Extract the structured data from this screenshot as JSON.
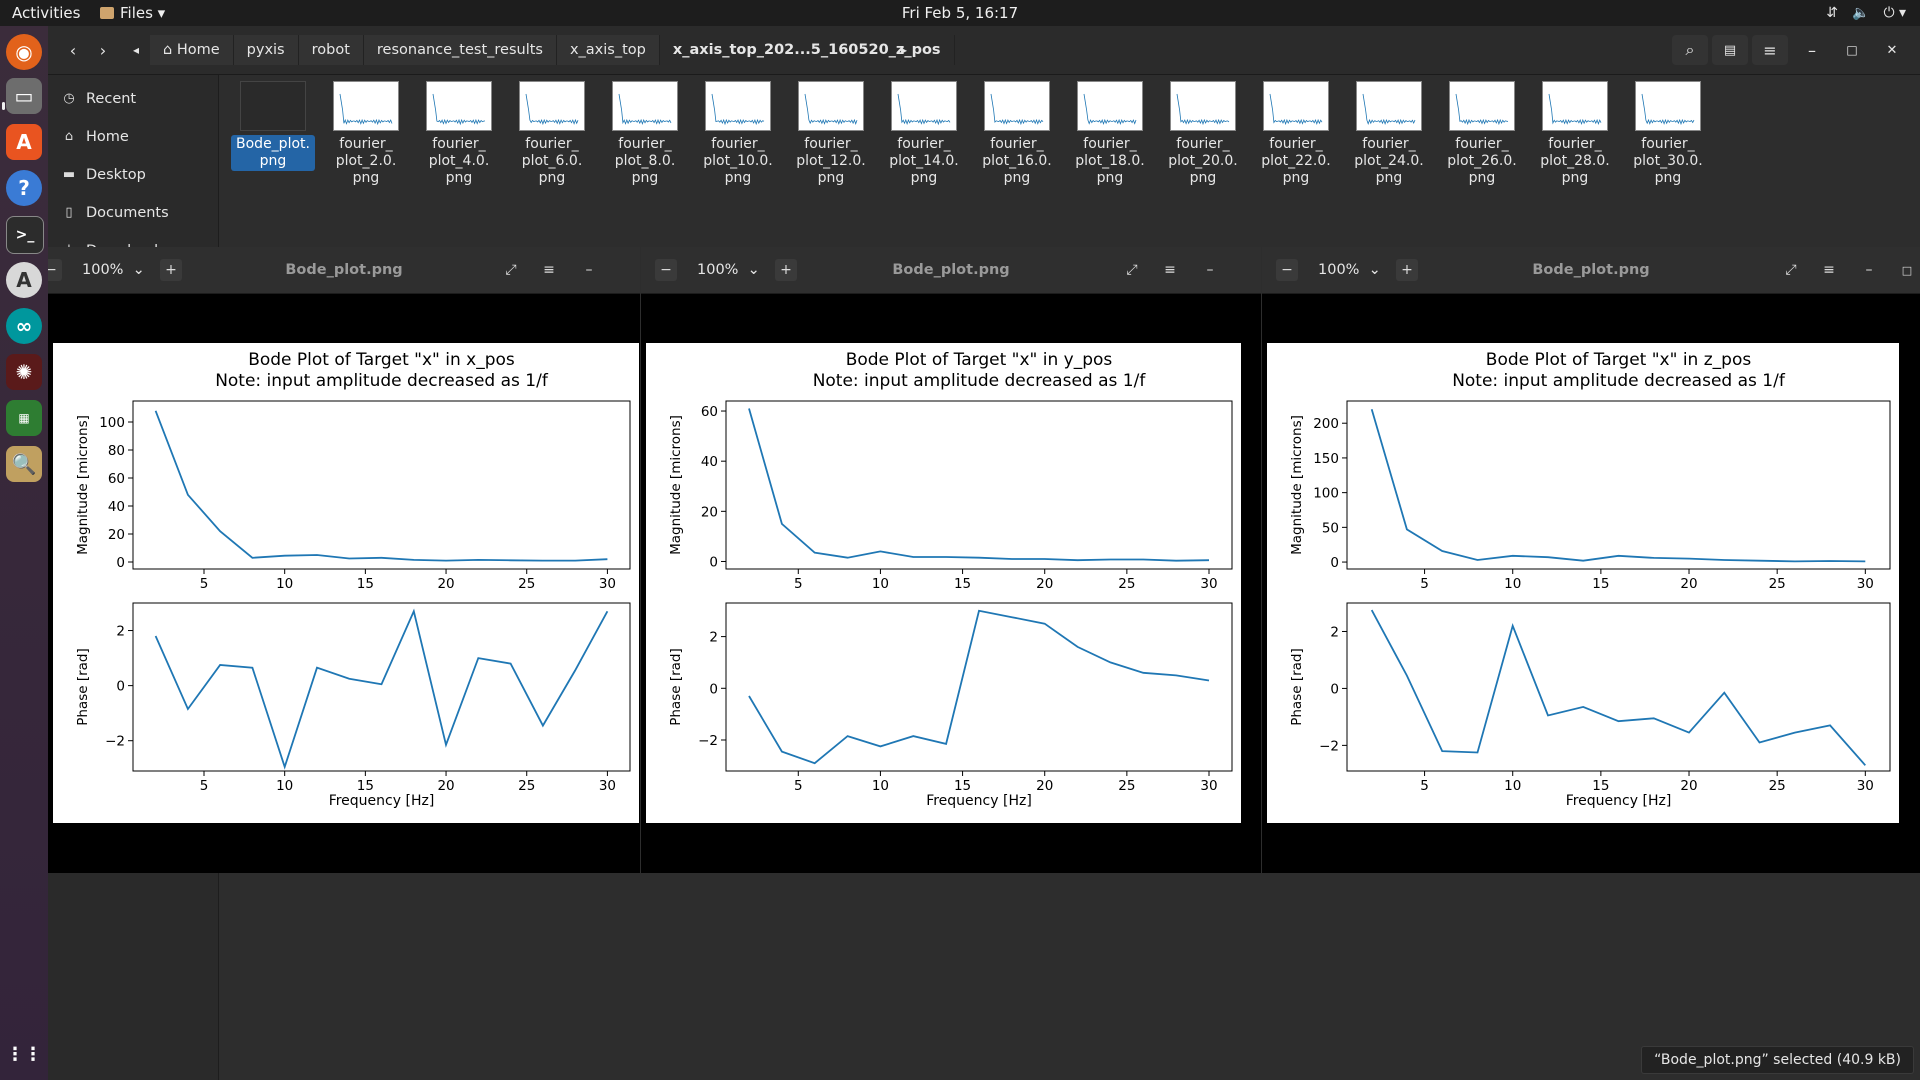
{
  "topbar": {
    "activities": "Activities",
    "app_menu": "Files ▾",
    "clock": "Fri Feb  5, 16:17"
  },
  "files": {
    "breadcrumbs": [
      "Home",
      "pyxis",
      "robot",
      "resonance_test_results",
      "x_axis_top",
      "x_axis_top_202...5_160520_z_pos"
    ],
    "sidebar": [
      "Recent",
      "Home",
      "Desktop",
      "Documents",
      "Downloads"
    ],
    "items": [
      {
        "name": "Bode_plot.\npng",
        "selected": true
      },
      {
        "name": "fourier_\nplot_2.0.\npng"
      },
      {
        "name": "fourier_\nplot_4.0.\npng"
      },
      {
        "name": "fourier_\nplot_6.0.\npng"
      },
      {
        "name": "fourier_\nplot_8.0.\npng"
      },
      {
        "name": "fourier_\nplot_10.0.\npng"
      },
      {
        "name": "fourier_\nplot_12.0.\npng"
      },
      {
        "name": "fourier_\nplot_14.0.\npng"
      },
      {
        "name": "fourier_\nplot_16.0.\npng"
      },
      {
        "name": "fourier_\nplot_18.0.\npng"
      },
      {
        "name": "fourier_\nplot_20.0.\npng"
      },
      {
        "name": "fourier_\nplot_22.0.\npng"
      },
      {
        "name": "fourier_\nplot_24.0.\npng"
      },
      {
        "name": "fourier_\nplot_26.0.\npng"
      },
      {
        "name": "fourier_\nplot_28.0.\npng"
      },
      {
        "name": "fourier_\nplot_30.0.\npng"
      }
    ],
    "status": "“Bode_plot.png” selected (40.9 kB)"
  },
  "viewers": [
    {
      "zoom": "100%",
      "title": "Bode_plot.png"
    },
    {
      "zoom": "100%",
      "title": "Bode_plot.png"
    },
    {
      "zoom": "100%",
      "title": "Bode_plot.png"
    }
  ],
  "chart_data": [
    {
      "type": "line",
      "title": "Bode Plot of Target \"x\" in x_pos\nNote: input amplitude decreased as 1/f",
      "xlabel": "Frequency [Hz]",
      "x": [
        2,
        4,
        6,
        8,
        10,
        12,
        14,
        16,
        18,
        20,
        22,
        24,
        26,
        28,
        30
      ],
      "xticks": [
        5,
        10,
        15,
        20,
        25,
        30
      ],
      "xlim": [
        0.6,
        31.4
      ],
      "magnitude": {
        "ylabel": "Magnitude [microns]",
        "yticks": [
          0,
          20,
          40,
          60,
          80,
          100
        ],
        "ylim": [
          -5,
          115
        ],
        "values": [
          108,
          48,
          22,
          3,
          4.5,
          5,
          2.5,
          3,
          1.5,
          1,
          1.5,
          1.2,
          1,
          1,
          2
        ]
      },
      "phase": {
        "ylabel": "Phase [rad]",
        "yticks": [
          -2,
          0,
          2
        ],
        "ylim": [
          -3.1,
          3.0
        ],
        "values": [
          1.8,
          -0.85,
          0.75,
          0.65,
          -2.95,
          0.65,
          0.25,
          0.05,
          2.7,
          -2.15,
          1.0,
          0.8,
          -1.45,
          0.55,
          2.7
        ]
      }
    },
    {
      "type": "line",
      "title": "Bode Plot of Target \"x\" in y_pos\nNote: input amplitude decreased as 1/f",
      "xlabel": "Frequency [Hz]",
      "x": [
        2,
        4,
        6,
        8,
        10,
        12,
        14,
        16,
        18,
        20,
        22,
        24,
        26,
        28,
        30
      ],
      "xticks": [
        5,
        10,
        15,
        20,
        25,
        30
      ],
      "xlim": [
        0.6,
        31.4
      ],
      "magnitude": {
        "ylabel": "Magnitude [microns]",
        "yticks": [
          0,
          20,
          40,
          60
        ],
        "ylim": [
          -3,
          64
        ],
        "values": [
          61,
          15,
          3.5,
          1.5,
          4,
          1.8,
          1.8,
          1.5,
          1,
          1,
          0.5,
          0.8,
          0.8,
          0.3,
          0.5
        ]
      },
      "phase": {
        "ylabel": "Phase [rad]",
        "yticks": [
          -2,
          0,
          2
        ],
        "ylim": [
          -3.2,
          3.3
        ],
        "values": [
          -0.3,
          -2.45,
          -2.9,
          -1.85,
          -2.25,
          -1.85,
          -2.15,
          3.0,
          2.75,
          2.5,
          1.6,
          1.0,
          0.6,
          0.5,
          0.3
        ]
      }
    },
    {
      "type": "line",
      "title": "Bode Plot of Target \"x\" in z_pos\nNote: input amplitude decreased as 1/f",
      "xlabel": "Frequency [Hz]",
      "x": [
        2,
        4,
        6,
        8,
        10,
        12,
        14,
        16,
        18,
        20,
        22,
        24,
        26,
        28,
        30
      ],
      "xticks": [
        5,
        10,
        15,
        20,
        25,
        30
      ],
      "xlim": [
        0.6,
        31.4
      ],
      "magnitude": {
        "ylabel": "Magnitude [microns]",
        "yticks": [
          0,
          50,
          100,
          150,
          200
        ],
        "ylim": [
          -10,
          232
        ],
        "values": [
          220,
          47,
          16,
          3,
          9,
          7,
          2,
          9,
          6,
          5,
          3,
          2,
          1,
          1.5,
          1
        ]
      },
      "phase": {
        "ylabel": "Phase [rad]",
        "yticks": [
          -2,
          0,
          2
        ],
        "ylim": [
          -2.9,
          3.0
        ],
        "values": [
          2.75,
          0.45,
          -2.2,
          -2.25,
          2.2,
          -0.95,
          -0.65,
          -1.15,
          -1.05,
          -1.55,
          -0.15,
          -1.9,
          -1.55,
          -1.3,
          -2.7
        ]
      }
    }
  ]
}
